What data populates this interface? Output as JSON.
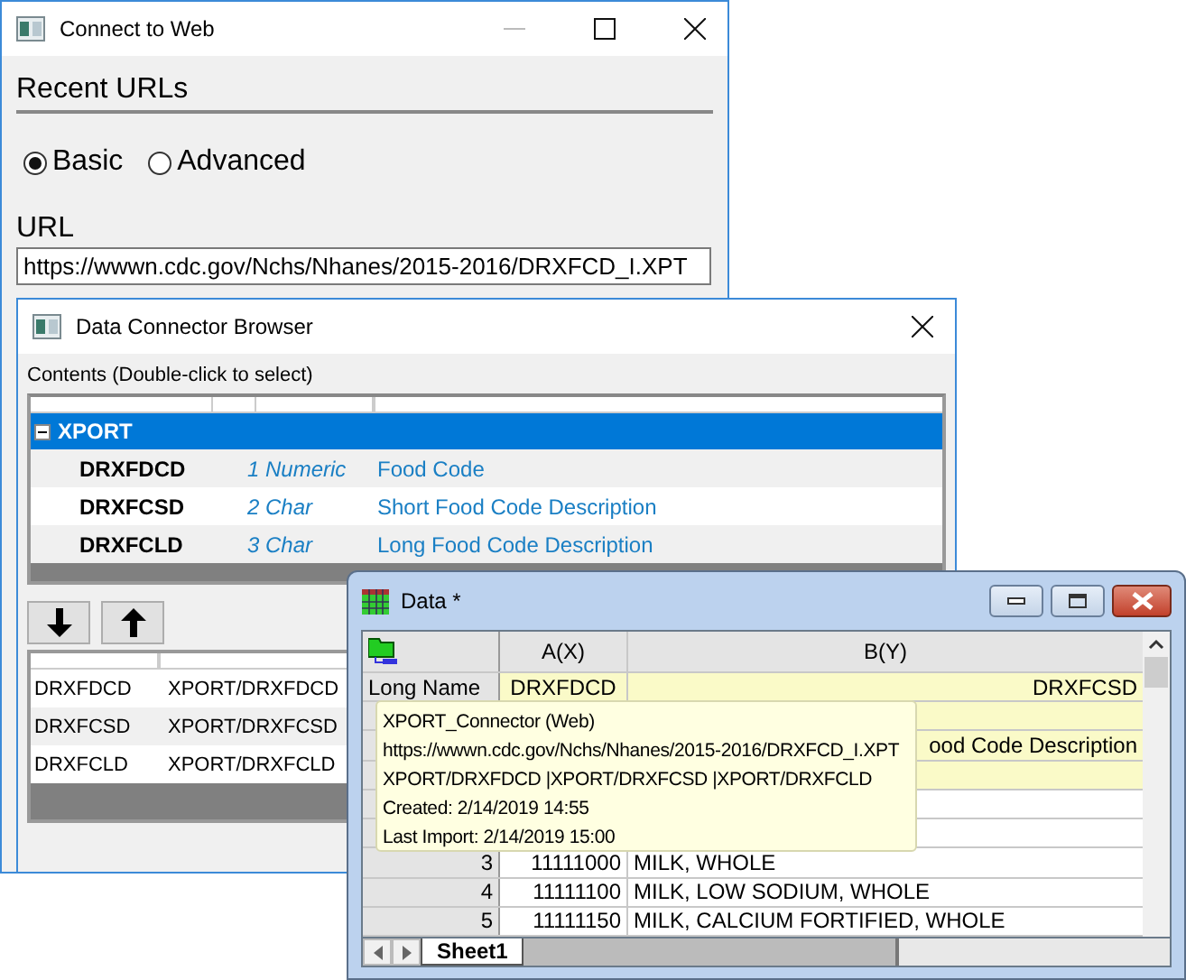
{
  "connect_window": {
    "title": "Connect to Web",
    "recent_label": "Recent URLs",
    "modes": [
      {
        "label": "Basic",
        "selected": true
      },
      {
        "label": "Advanced",
        "selected": false
      }
    ],
    "url_label": "URL",
    "url": "https://wwwn.cdc.gov/Nchs/Nhanes/2015-2016/DRXFCD_I.XPT"
  },
  "browser_window": {
    "title": "Data Connector Browser",
    "contents_label": "Contents (Double-click to select)",
    "tree": [
      {
        "name": "XPORT",
        "expanded": true,
        "selected": true,
        "children": [
          {
            "name": "DRXFDCD",
            "type": "1 Numeric",
            "description": "Food Code",
            "selected": false
          },
          {
            "name": "DRXFCSD",
            "type": "2 Char",
            "description": "Short Food Code Description",
            "selected": false
          },
          {
            "name": "DRXFCLD",
            "type": "3 Char",
            "description": "Long Food Code Description",
            "selected": false
          }
        ]
      }
    ],
    "selected_list": [
      {
        "name": "DRXFDCD",
        "path": "XPORT/DRXFDCD"
      },
      {
        "name": "DRXFCSD",
        "path": "XPORT/DRXFCSD"
      },
      {
        "name": "DRXFCLD",
        "path": "XPORT/DRXFCLD"
      }
    ]
  },
  "data_window": {
    "title": "Data *",
    "columns": [
      "A(X)",
      "B(Y)"
    ],
    "label_rows": [
      {
        "label": "Long Name",
        "a": "DRXFDCD",
        "b": "DRXFCSD"
      },
      {},
      {
        "b": "ood Code Description"
      },
      {}
    ],
    "rows": [
      {},
      {},
      {
        "index": "3",
        "a": "11111000",
        "b": "MILK, WHOLE"
      },
      {
        "index": "4",
        "a": "11111100",
        "b": "MILK, LOW SODIUM, WHOLE"
      },
      {
        "index": "5",
        "a": "11111150",
        "b": "MILK, CALCIUM FORTIFIED, WHOLE"
      }
    ],
    "sheets": [
      {
        "label": "Sheet1",
        "selected": true
      }
    ],
    "tooltip": [
      "XPORT_Connector (Web)",
      "https://wwwn.cdc.gov/Nchs/Nhanes/2015-2016/DRXFCD_I.XPT",
      "XPORT/DRXFDCD |XPORT/DRXFCSD |XPORT/DRXFCLD",
      "Created: 2/14/2019 14:55",
      "Last Import: 2/14/2019 15:00"
    ]
  }
}
